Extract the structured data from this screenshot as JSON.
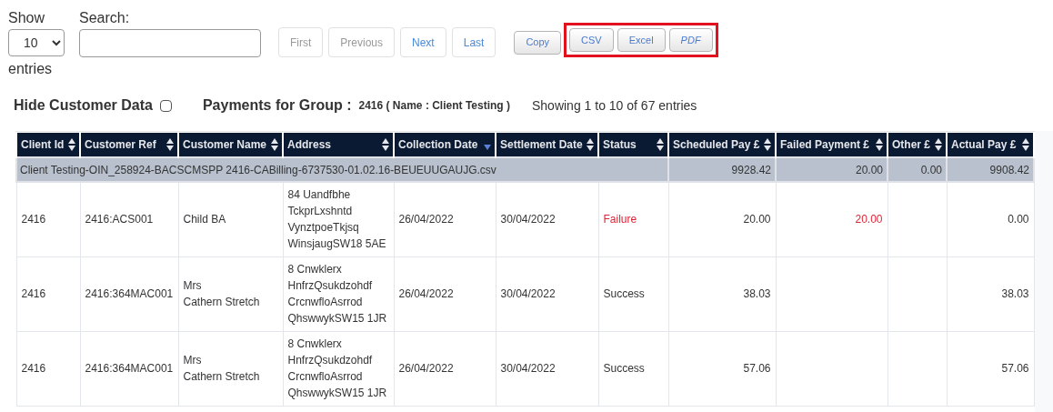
{
  "length_control": {
    "label": "Show",
    "value": "10",
    "suffix": "entries"
  },
  "search": {
    "label": "Search:"
  },
  "pagination": [
    {
      "label": "First",
      "disabled": true
    },
    {
      "label": "Previous",
      "disabled": true
    },
    {
      "label": "Next",
      "disabled": false
    },
    {
      "label": "Last",
      "disabled": false
    }
  ],
  "export_buttons": [
    {
      "label": "Copy",
      "highlighted": false,
      "italic": false
    },
    {
      "label": "CSV",
      "highlighted": true,
      "italic": false
    },
    {
      "label": "Excel",
      "highlighted": true,
      "italic": false
    },
    {
      "label": "PDF",
      "highlighted": true,
      "italic": true
    }
  ],
  "hide_customer_data": {
    "label": "Hide Customer Data",
    "checked": false
  },
  "group_title": {
    "label": "Payments for Group :",
    "value": "2416 ( Name : Client Testing )"
  },
  "info": "Showing 1 to 10 of 67 entries",
  "table": {
    "columns": [
      {
        "label": "Client Id",
        "sorted": false
      },
      {
        "label": "Customer Ref",
        "sorted": false
      },
      {
        "label": "Customer Name",
        "sorted": false
      },
      {
        "label": "Address",
        "sorted": false
      },
      {
        "label": "Collection Date",
        "sorted": true
      },
      {
        "label": "Settlement Date",
        "sorted": false
      },
      {
        "label": "Status",
        "sorted": false
      },
      {
        "label": "Scheduled Pay £",
        "sorted": false
      },
      {
        "label": "Failed Payment £",
        "sorted": false
      },
      {
        "label": "Other £",
        "sorted": false
      },
      {
        "label": "Actual Pay £",
        "sorted": false
      }
    ],
    "group_row": {
      "label": "Client Testing-OIN_258924-BACSCMSPP 2416-CABilling-6737530-01.02.16-BEUEUUGAUJG.csv",
      "scheduled": "9928.42",
      "failed": "20.00",
      "other": "0.00",
      "actual": "9908.42"
    },
    "rows": [
      {
        "client_id": "2416",
        "customer_ref": "2416:ACS001",
        "customer_name": [
          "Child BA"
        ],
        "address": [
          "84 Uandfbhe",
          "TckprLxshntd",
          "VynztpoeTkjsq",
          "WinsjaugSW18 5AE"
        ],
        "collection_date": "26/04/2022",
        "settlement_date": "30/04/2022",
        "status": "Failure",
        "kind": "failure",
        "scheduled": "20.00",
        "failed": "20.00",
        "actual": "0.00"
      },
      {
        "client_id": "2416",
        "customer_ref": "2416:364MAC001",
        "customer_name": [
          "Mrs",
          "Cathern Stretch"
        ],
        "address": [
          "8 Cnwklerx",
          "HnfrzQsukdzohdf",
          "CrcnwfloAsrrod",
          "QhswwykSW15 1JR"
        ],
        "collection_date": "26/04/2022",
        "settlement_date": "30/04/2022",
        "status": "Success",
        "kind": "success",
        "scheduled": "38.03",
        "actual": "38.03"
      },
      {
        "client_id": "2416",
        "customer_ref": "2416:364MAC001",
        "customer_name": [
          "Mrs",
          "Cathern Stretch"
        ],
        "address": [
          "8 Cnwklerx",
          "HnfrzQsukdzohdf",
          "CrcnwfloAsrrod",
          "QhswwykSW15 1JR"
        ],
        "collection_date": "26/04/2022",
        "settlement_date": "30/04/2022",
        "status": "Success",
        "kind": "success",
        "scheduled": "57.06",
        "actual": "57.06"
      }
    ]
  }
}
